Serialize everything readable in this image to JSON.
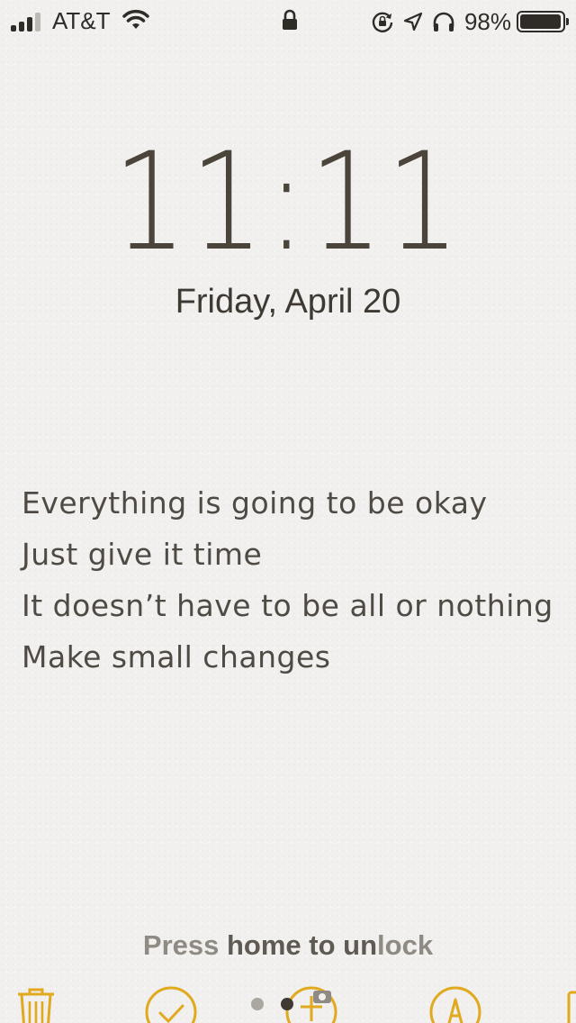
{
  "status_bar": {
    "carrier": "AT&T",
    "battery_percent_text": "98%",
    "battery_level": 0.98,
    "icons": [
      "signal-icon",
      "wifi-icon",
      "lock-icon",
      "rotation-lock-icon",
      "location-icon",
      "headphones-icon",
      "battery-icon"
    ]
  },
  "lock_screen": {
    "time": "11:11",
    "date": "Friday, April 20",
    "unlock_hint_prefix": "Press ",
    "unlock_hint_bold": "home to un",
    "unlock_hint_suffix": "lock"
  },
  "wallpaper_quote": {
    "lines": [
      "Everything is going to be okay",
      "Just give it time",
      "It doesn’t have to be all or nothing",
      "Make small changes"
    ]
  },
  "page_indicator": {
    "count": 2,
    "active_index": 1
  },
  "colors": {
    "accent_yellow": "#e0a91e",
    "text_dark": "#3e3a33"
  },
  "dock_icons": [
    "trash-icon",
    "checkmark-icon",
    "camera-icon",
    "markup-icon",
    "note-edge-icon"
  ]
}
